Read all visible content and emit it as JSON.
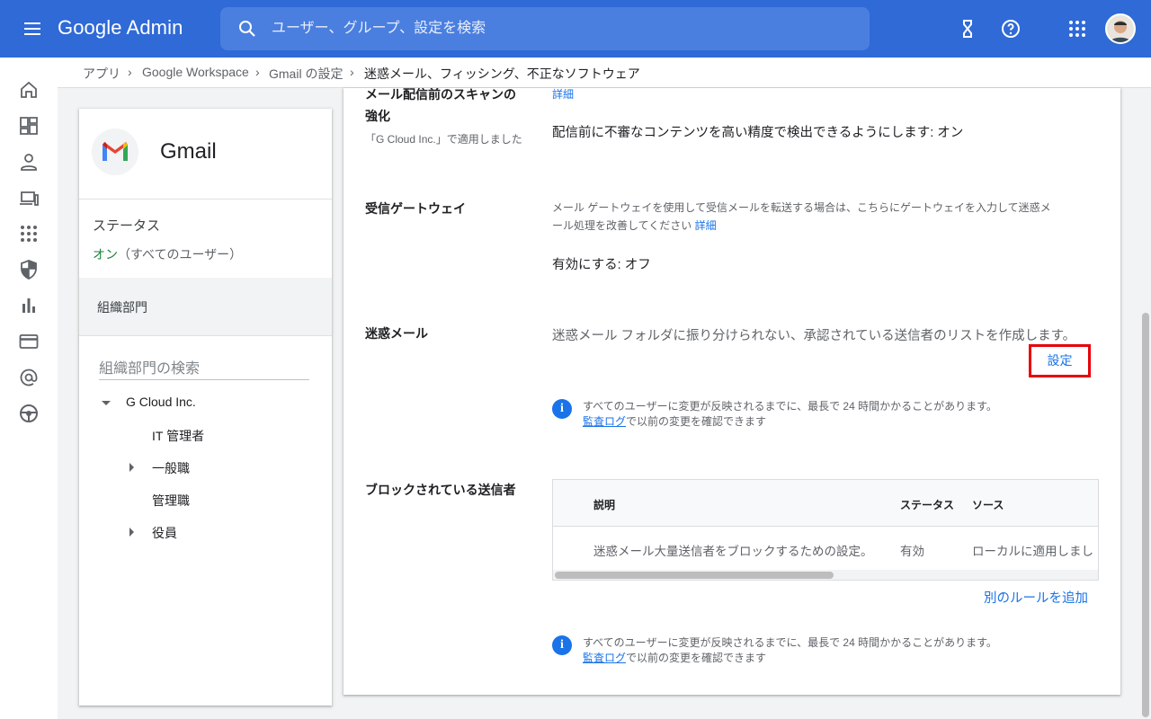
{
  "header": {
    "logo": "Google Admin",
    "search_placeholder": "ユーザー、グループ、設定を検索"
  },
  "breadcrumb": {
    "items": [
      "アプリ",
      "Google Workspace",
      "Gmail の設定"
    ],
    "current": "迷惑メール、フィッシング、不正なソフトウェア"
  },
  "app_card": {
    "name": "Gmail",
    "status_title": "ステータス",
    "status_on": "オン",
    "status_scope": "（すべてのユーザー）",
    "org_header": "組織部門",
    "org_search_placeholder": "組織部門の検索",
    "tree": [
      {
        "label": "G Cloud Inc.",
        "expander": "expanded"
      },
      {
        "label": "IT 管理者",
        "expander": "none"
      },
      {
        "label": "一般職",
        "expander": "collapsed"
      },
      {
        "label": "管理職",
        "expander": "none"
      },
      {
        "label": "役員",
        "expander": "collapsed"
      }
    ]
  },
  "main": {
    "enhanced_scan": {
      "title_line1": "メール配信前のスキャンの",
      "title_line2": "強化",
      "applied": "「G Cloud Inc.」で適用しました",
      "detail_link": "詳細",
      "value": "配信前に不審なコンテンツを高い精度で検出できるようにします: オン"
    },
    "inbound_gateway": {
      "title": "受信ゲートウェイ",
      "desc_line1": "メール ゲートウェイを使用して受信メールを転送する場合は、こちらにゲートウェイを入力して迷惑メ",
      "desc_line2": "ール処理を改善してください",
      "detail_link": "詳細",
      "value": "有効にする: オフ"
    },
    "spam": {
      "title": "迷惑メール",
      "desc": "迷惑メール フォルダに振り分けられない、承認されている送信者のリストを作成します。",
      "settings_button": "設定",
      "info_line1": "すべてのユーザーに変更が反映されるまでに、最長で 24 時間かかることがあります。",
      "audit_link": "監査ログ",
      "info_line2_rest": "で以前の変更を確認できます"
    },
    "blocked_senders": {
      "title": "ブロックされている送信者",
      "columns": [
        "説明",
        "ステータス",
        "ソース"
      ],
      "rows": [
        {
          "desc": "迷惑メール大量送信者をブロックするための設定。",
          "status": "有効",
          "source": "ローカルに適用しまし"
        }
      ],
      "add_rule": "別のルールを追加",
      "info_line1": "すべてのユーザーに変更が反映されるまでに、最長で 24 時間かかることがあります。",
      "audit_link": "監査ログ",
      "info_line2_rest": "で以前の変更を確認できます"
    }
  },
  "rail_icons": [
    "home-icon",
    "dashboard-icon",
    "person-icon",
    "devices-icon",
    "apps-icon",
    "security-icon",
    "reports-icon",
    "billing-icon",
    "account-at-icon",
    "rules-icon"
  ],
  "colors": {
    "topbar": "#2f6ad6",
    "accent": "#1a73e8",
    "highlight_box": "#e8000a",
    "status_on": "#188038"
  }
}
